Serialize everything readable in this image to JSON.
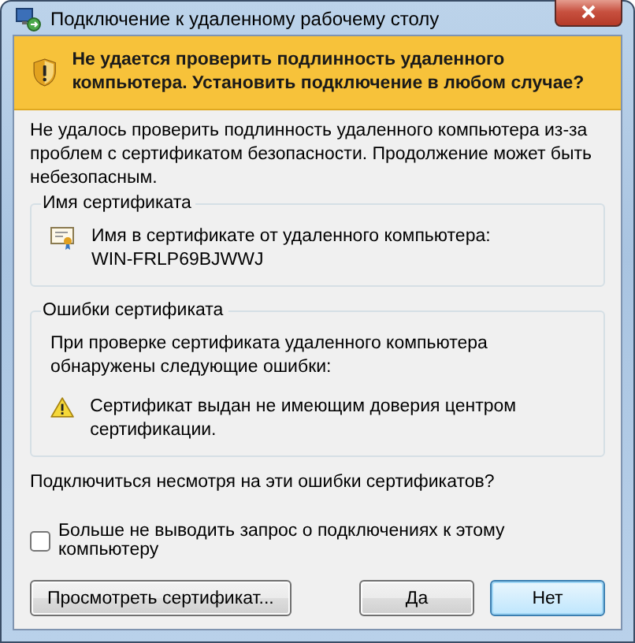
{
  "window": {
    "title": "Подключение к удаленному рабочему столу"
  },
  "banner": {
    "text": "Не удается проверить подлинность удаленного компьютера. Установить подключение в любом случае?"
  },
  "message": "Не удалось проверить подлинность удаленного компьютера из-за проблем с сертификатом безопасности. Продолжение может быть небезопасным.",
  "certificate_name": {
    "legend": "Имя сертификата",
    "label": "Имя в сертификате от удаленного компьютера:",
    "value": "WIN-FRLP69BJWWJ"
  },
  "certificate_errors": {
    "legend": "Ошибки сертификата",
    "intro": "При проверке сертификата удаленного компьютера обнаружены следующие ошибки:",
    "errors": [
      "Сертификат выдан не имеющим доверия центром сертификации."
    ]
  },
  "question": "Подключиться несмотря на эти ошибки сертификатов?",
  "dont_ask": {
    "label": "Больше не выводить запрос о подключениях к этому компьютеру",
    "checked": false
  },
  "buttons": [
    {
      "label": "Просмотреть сертификат...",
      "default": false
    },
    {
      "label": "Да",
      "default": false
    },
    {
      "label": "Нет",
      "default": true
    }
  ]
}
